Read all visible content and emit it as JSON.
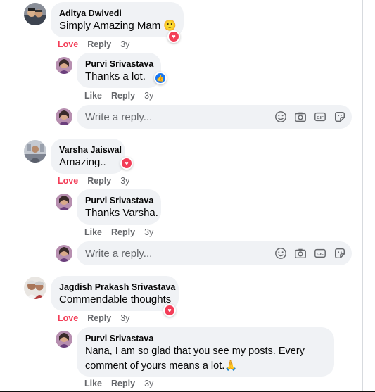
{
  "comments": [
    {
      "author": "Aditya Dwivedi",
      "text": "Simply Amazing Mam 🙂",
      "actions": {
        "love": "Love",
        "reply": "Reply",
        "time": "3y"
      },
      "reply": {
        "author": "Purvi Srivastava",
        "text": "Thanks a lot.",
        "actions": {
          "like": "Like",
          "reply": "Reply",
          "time": "3y"
        }
      }
    },
    {
      "author": "Varsha Jaiswal",
      "text": "Amazing..",
      "actions": {
        "love": "Love",
        "reply": "Reply",
        "time": "3y"
      },
      "reply": {
        "author": "Purvi Srivastava",
        "text": "Thanks Varsha.",
        "actions": {
          "like": "Like",
          "reply": "Reply",
          "time": "3y"
        }
      }
    },
    {
      "author": "Jagdish Prakash Srivastava",
      "text": "Commendable thoughts",
      "actions": {
        "love": "Love",
        "reply": "Reply",
        "time": "3y"
      },
      "reply": {
        "author": "Purvi Srivastava",
        "text": "Nana, I am so glad that you see my posts. Every comment of yours means a lot.🙏",
        "actions": {
          "like": "Like",
          "reply": "Reply",
          "time": "3y"
        }
      }
    }
  ],
  "reply_box": {
    "placeholder": "Write a reply..."
  },
  "reaction_icons": {
    "love": "heart-icon",
    "like": "thumbs-up-icon"
  },
  "composer_icons": [
    "emoji-icon",
    "camera-icon",
    "gif-icon",
    "sticker-icon"
  ],
  "colors": {
    "bubble": "#f0f2f5",
    "love": "#f33e58",
    "like": "#1877f2",
    "meta": "#65676b"
  }
}
